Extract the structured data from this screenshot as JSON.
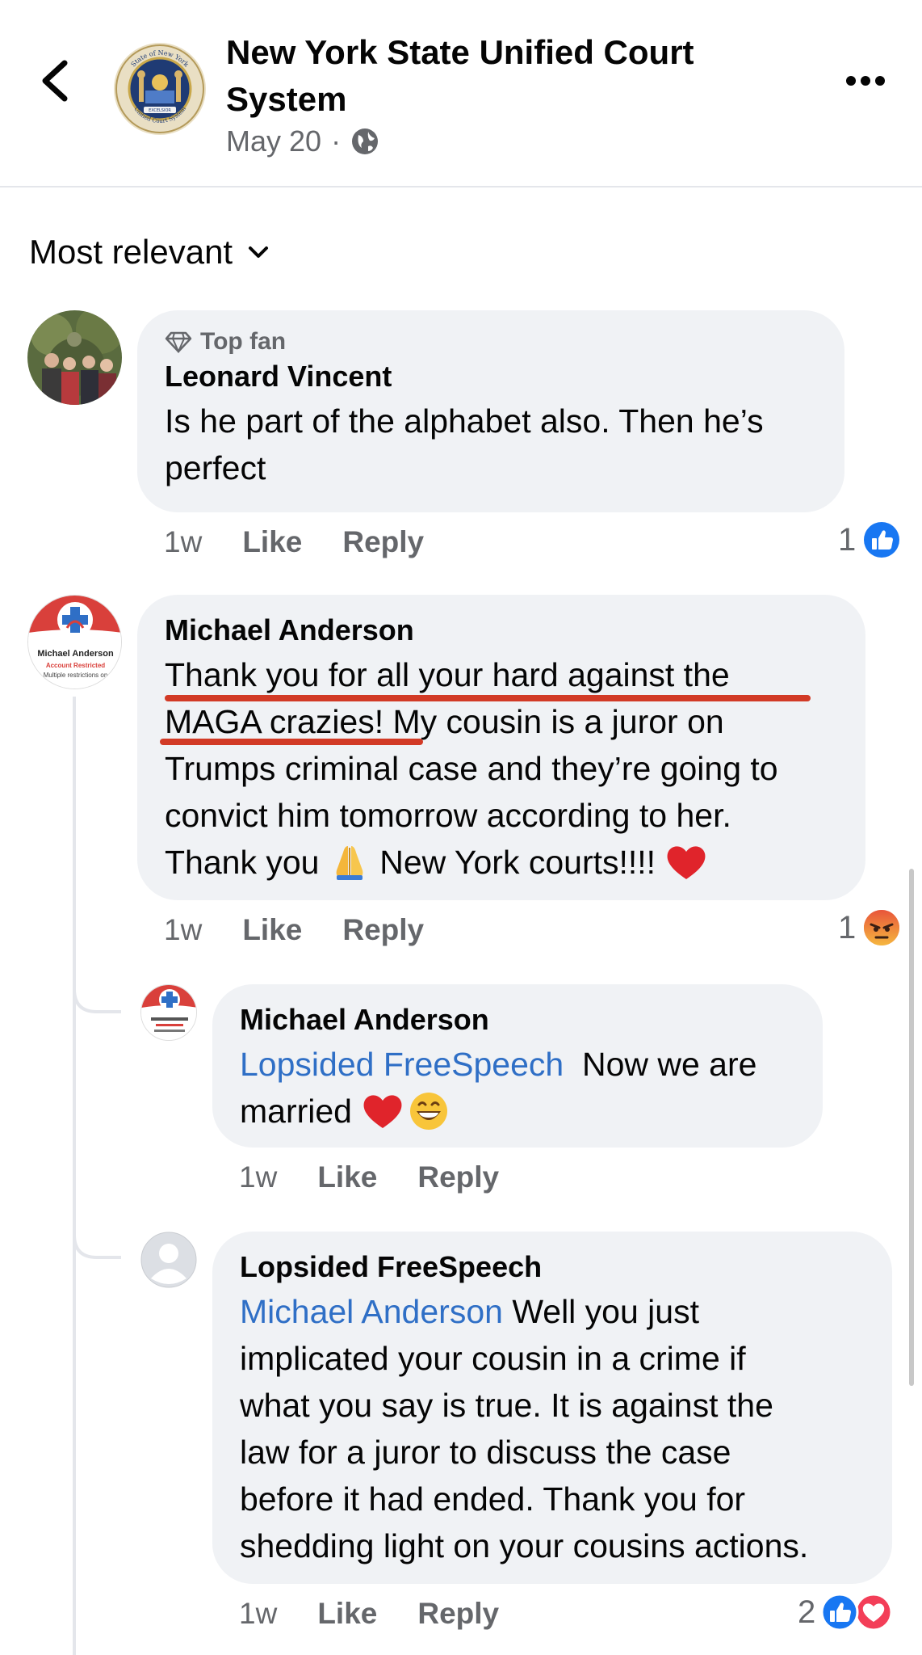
{
  "header": {
    "page_name": "New York State Unified Court System",
    "date": "May 20",
    "separator": "·",
    "seal_text_top": "State of New York",
    "seal_text_bottom": "Unified Court System",
    "seal_banner": "EXCELSIOR"
  },
  "sort": {
    "label": "Most relevant"
  },
  "comments": [
    {
      "badge": "Top fan",
      "author": "Leonard Vincent",
      "text": "Is he part of the alphabet also. Then he’s perfect",
      "time": "1w",
      "like_label": "Like",
      "reply_label": "Reply",
      "reaction_count": "1",
      "reaction_types": [
        "like"
      ]
    },
    {
      "author": "Michael Anderson",
      "avatar_name": "Michael Anderson",
      "avatar_status": "Account Restricted",
      "avatar_sub": "Multiple restrictions on",
      "text_line1": "Thank you for all your hard against the",
      "text_line2a": "MAGA crazies!",
      "text_line2b": " My cousin is a juror on",
      "text_line3": "Trumps criminal case and they’re going to",
      "text_line4": "convict him tomorrow according to her.",
      "text_line5a": "Thank you ",
      "text_line5b": " New York courts!!!! ",
      "time": "1w",
      "like_label": "Like",
      "reply_label": "Reply",
      "reaction_count": "1",
      "reaction_types": [
        "angry"
      ],
      "annotation_color": "#d23a26"
    }
  ],
  "replies": [
    {
      "author": "Michael Anderson",
      "mention": "Lopsided FreeSpeech",
      "text_after_mention": "  Now we are",
      "text_line2": "married ",
      "time": "1w",
      "like_label": "Like",
      "reply_label": "Reply"
    },
    {
      "author": "Lopsided FreeSpeech",
      "mention": "Michael Anderson",
      "text_after_mention": " Well you just",
      "text_lines": [
        "implicated your cousin in a crime if",
        "what you say is true. It is against the",
        "law for a juror to discuss the case",
        "before it had ended. Thank you for",
        "shedding light on your cousins actions."
      ],
      "time": "1w",
      "like_label": "Like",
      "reply_label": "Reply",
      "reaction_count": "2",
      "reaction_types": [
        "like",
        "love"
      ]
    }
  ],
  "icons": [
    "back-arrow-icon",
    "more-options-icon",
    "globe-icon",
    "chevron-down-icon",
    "diamond-icon",
    "like-icon",
    "angry-icon",
    "love-icon",
    "red-heart-emoji",
    "folded-hands-emoji",
    "grinning-emoji"
  ],
  "colors": {
    "link": "#2f6fc6",
    "like_blue": "#1877f2",
    "love_red": "#f33e58",
    "bubble": "#f0f2f5",
    "muted": "#65676b"
  }
}
